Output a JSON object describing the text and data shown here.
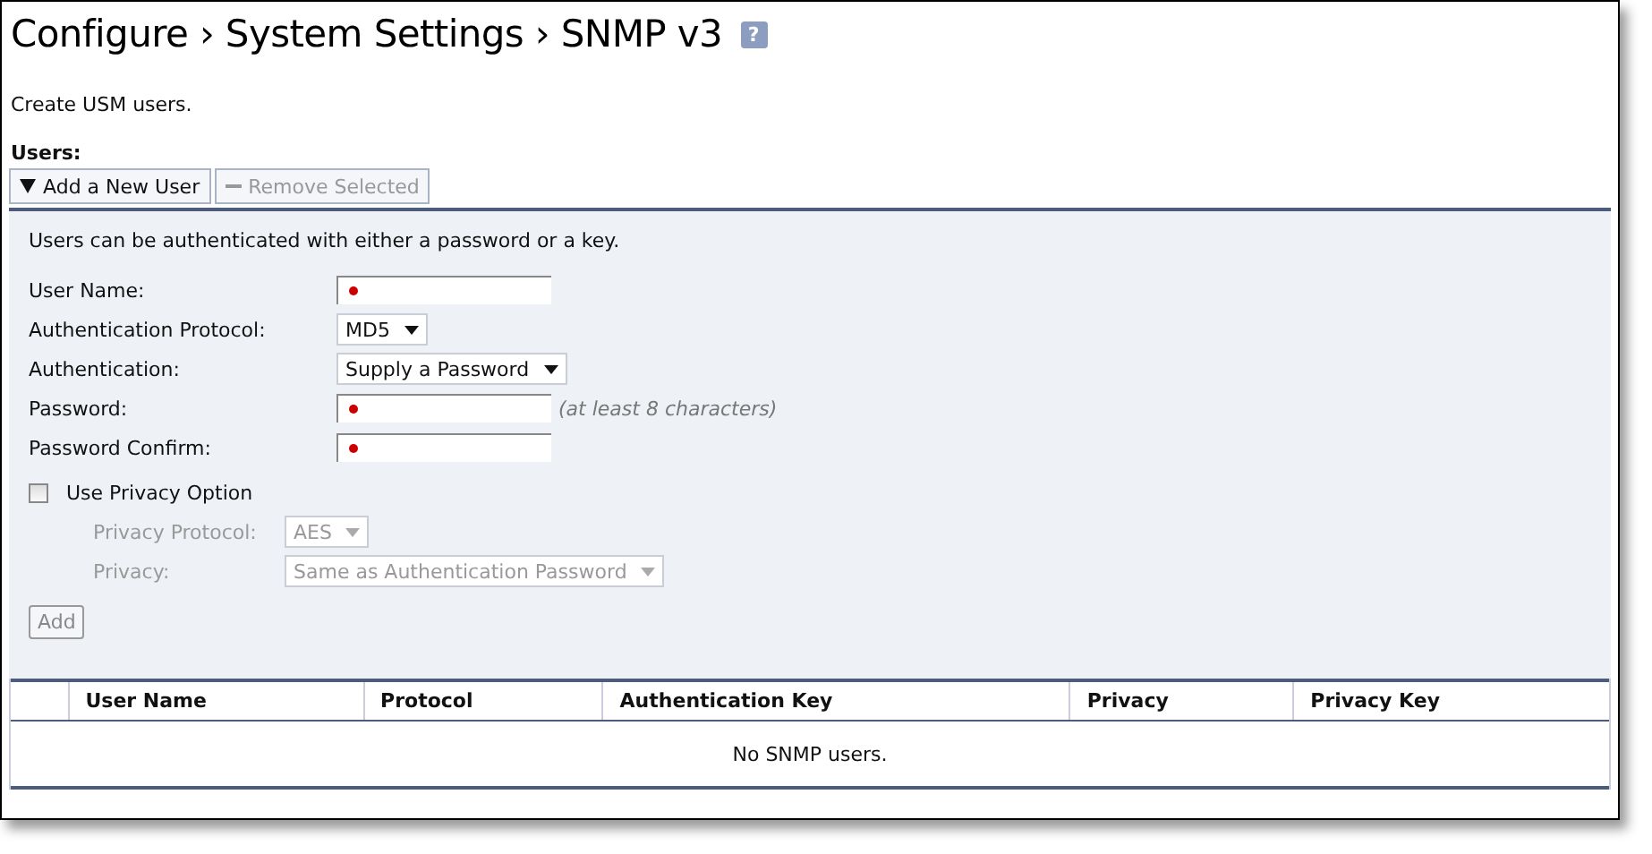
{
  "title": "Configure › System Settings › SNMP v3",
  "help": "?",
  "description": "Create USM users.",
  "users_label": "Users:",
  "toolbar": [
    {
      "label": "Add a New User",
      "kind": "expand",
      "disabled": false
    },
    {
      "label": "Remove Selected",
      "kind": "remove",
      "disabled": true
    }
  ],
  "form": {
    "intro": "Users can be authenticated with either a password or a key.",
    "fields": [
      {
        "label": "User Name:",
        "kind": "text",
        "required": true
      },
      {
        "label": "Authentication Protocol:",
        "kind": "select",
        "value": "MD5"
      },
      {
        "label": "Authentication:",
        "kind": "select",
        "value": "Supply a Password"
      },
      {
        "label": "Password:",
        "kind": "text",
        "required": true,
        "hint": "(at least 8 characters)"
      },
      {
        "label": "Password Confirm:",
        "kind": "text",
        "required": true
      }
    ],
    "privacy_option": {
      "label": "Use Privacy Option",
      "checked": false
    },
    "privacy_fields": [
      {
        "label": "Privacy Protocol:",
        "kind": "select",
        "value": "AES",
        "disabled": true
      },
      {
        "label": "Privacy:",
        "kind": "select",
        "value": "Same as Authentication Password",
        "disabled": true
      }
    ],
    "add_button": {
      "label": "Add",
      "disabled": true
    }
  },
  "table": {
    "columns": [
      "User Name",
      "Protocol",
      "Authentication Key",
      "Privacy",
      "Privacy Key"
    ],
    "empty_message": "No SNMP users."
  }
}
